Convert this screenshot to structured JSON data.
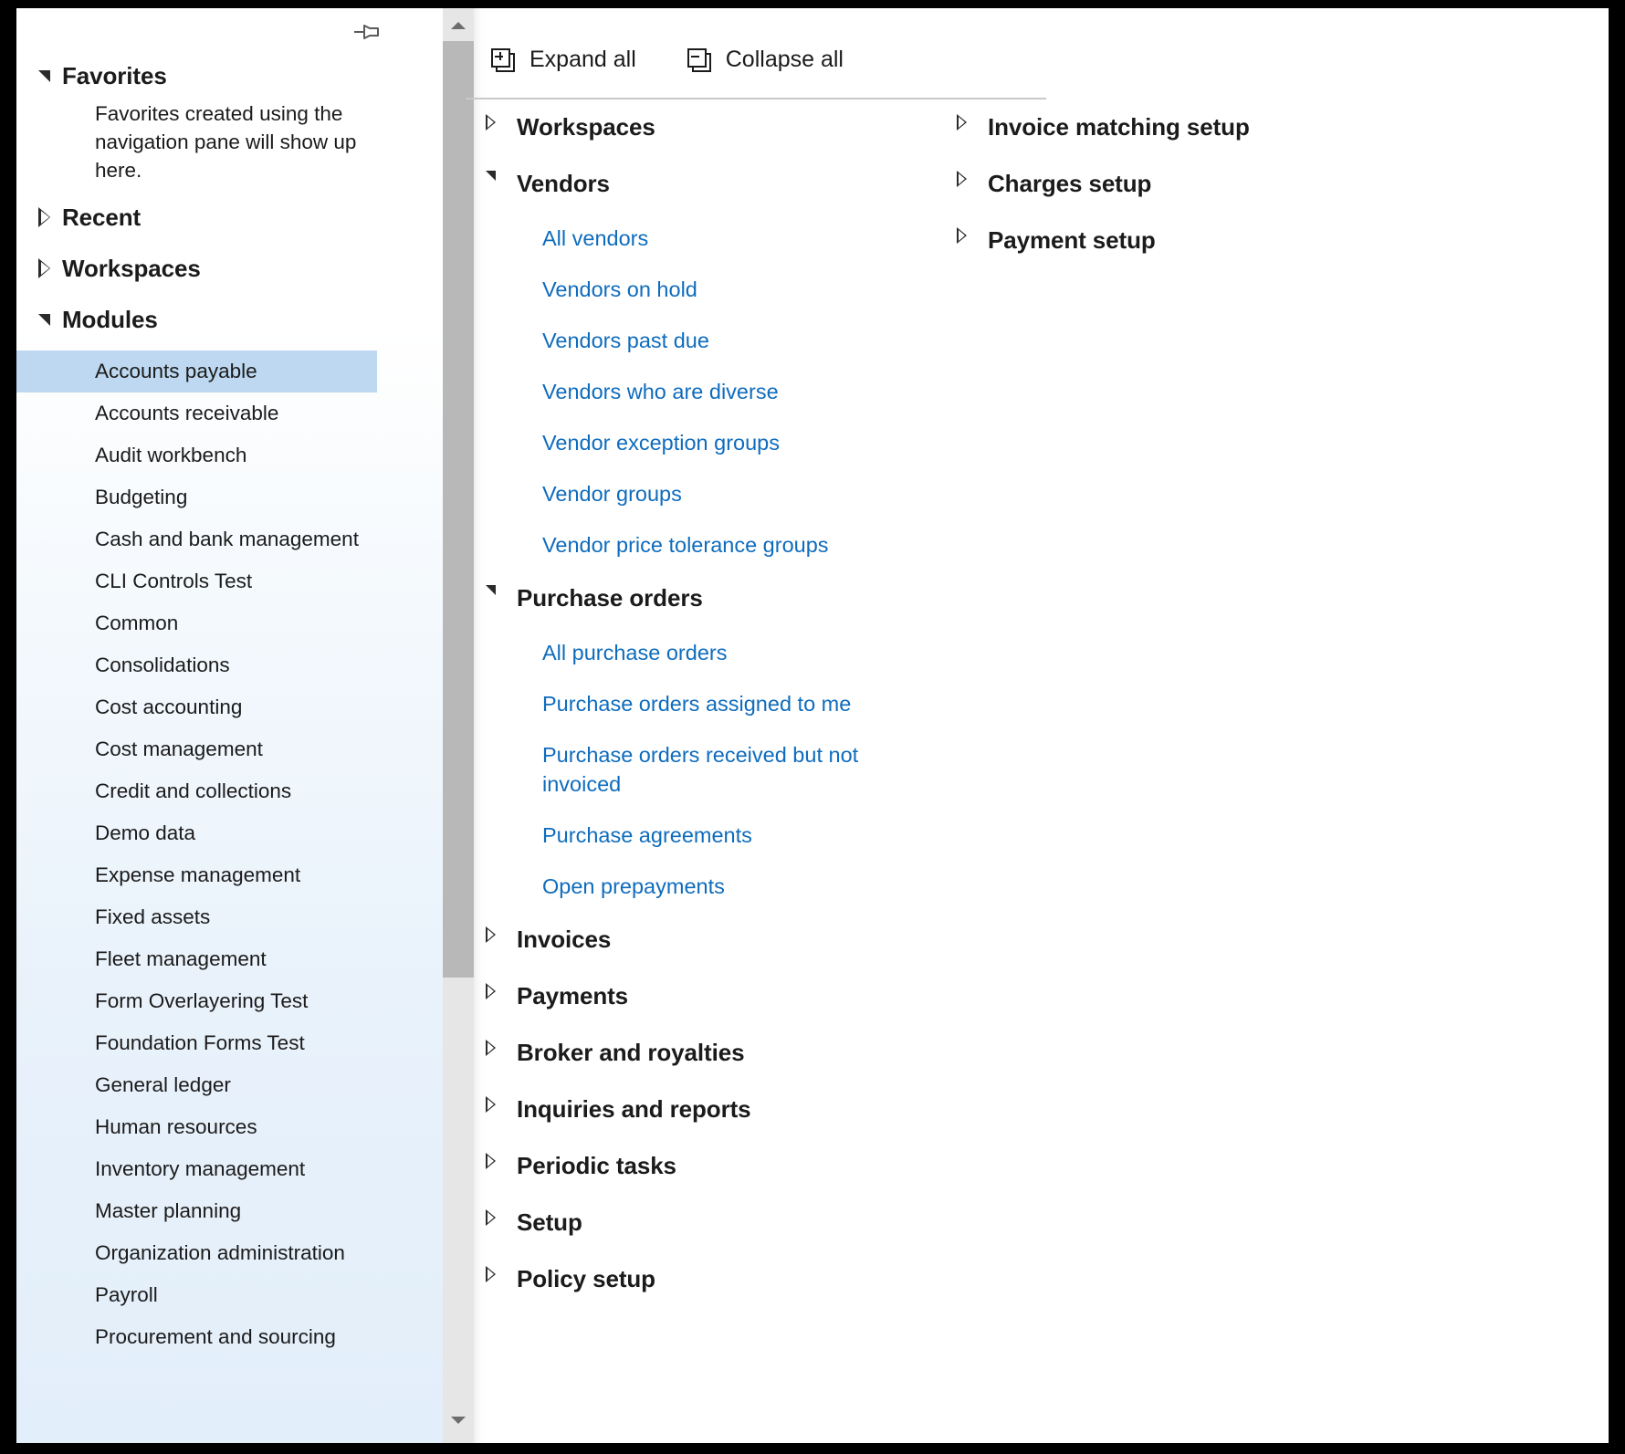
{
  "colors": {
    "link": "#0f6cbd",
    "selected_row": "#bdd8f0",
    "text": "#1b1b1b",
    "divider": "#c9c9c9",
    "scrollbar_thumb": "#b8b8b8",
    "scrollbar_track": "#e6e6e6"
  },
  "nav_pane": {
    "pin_icon": "pin-icon",
    "groups": [
      {
        "label": "Favorites",
        "expanded": true,
        "caret": "triangle-down-icon"
      },
      {
        "label": "Recent",
        "expanded": false,
        "caret": "triangle-right-icon"
      },
      {
        "label": "Workspaces",
        "expanded": false,
        "caret": "triangle-right-icon"
      },
      {
        "label": "Modules",
        "expanded": true,
        "caret": "triangle-down-icon"
      }
    ],
    "favorites_note": "Favorites created using the navigation pane will show up here.",
    "modules": [
      {
        "label": "Accounts payable",
        "selected": true
      },
      {
        "label": "Accounts receivable",
        "selected": false
      },
      {
        "label": "Audit workbench",
        "selected": false
      },
      {
        "label": "Budgeting",
        "selected": false
      },
      {
        "label": "Cash and bank management",
        "selected": false
      },
      {
        "label": "CLI Controls Test",
        "selected": false
      },
      {
        "label": "Common",
        "selected": false
      },
      {
        "label": "Consolidations",
        "selected": false
      },
      {
        "label": "Cost accounting",
        "selected": false
      },
      {
        "label": "Cost management",
        "selected": false
      },
      {
        "label": "Credit and collections",
        "selected": false
      },
      {
        "label": "Demo data",
        "selected": false
      },
      {
        "label": "Expense management",
        "selected": false
      },
      {
        "label": "Fixed assets",
        "selected": false
      },
      {
        "label": "Fleet management",
        "selected": false
      },
      {
        "label": "Form Overlayering Test",
        "selected": false
      },
      {
        "label": "Foundation Forms Test",
        "selected": false
      },
      {
        "label": "General ledger",
        "selected": false
      },
      {
        "label": "Human resources",
        "selected": false
      },
      {
        "label": "Inventory management",
        "selected": false
      },
      {
        "label": "Master planning",
        "selected": false
      },
      {
        "label": "Organization administration",
        "selected": false
      },
      {
        "label": "Payroll",
        "selected": false
      },
      {
        "label": "Procurement and sourcing",
        "selected": false
      }
    ],
    "scrollbar": {
      "up_arrow": "chevron-up-icon",
      "down_arrow": "chevron-down-icon"
    }
  },
  "toolbar": {
    "expand_all": {
      "label": "Expand all",
      "icon": "expand-all-icon"
    },
    "collapse_all": {
      "label": "Collapse all",
      "icon": "collapse-all-icon"
    }
  },
  "tree": {
    "left_column": [
      {
        "label": "Workspaces",
        "expanded": false,
        "children": []
      },
      {
        "label": "Vendors",
        "expanded": true,
        "children": [
          "All vendors",
          "Vendors on hold",
          "Vendors past due",
          "Vendors who are diverse",
          "Vendor exception groups",
          "Vendor groups",
          "Vendor price tolerance groups"
        ]
      },
      {
        "label": "Purchase orders",
        "expanded": true,
        "children": [
          "All purchase orders",
          "Purchase orders assigned to me",
          "Purchase orders received but not invoiced",
          "Purchase agreements",
          "Open prepayments"
        ]
      },
      {
        "label": "Invoices",
        "expanded": false,
        "children": []
      },
      {
        "label": "Payments",
        "expanded": false,
        "children": []
      },
      {
        "label": "Broker and royalties",
        "expanded": false,
        "children": []
      },
      {
        "label": "Inquiries and reports",
        "expanded": false,
        "children": []
      },
      {
        "label": "Periodic tasks",
        "expanded": false,
        "children": []
      },
      {
        "label": "Setup",
        "expanded": false,
        "children": []
      },
      {
        "label": "Policy setup",
        "expanded": false,
        "children": []
      }
    ],
    "right_column": [
      {
        "label": "Invoice matching setup",
        "expanded": false,
        "children": []
      },
      {
        "label": "Charges setup",
        "expanded": false,
        "children": []
      },
      {
        "label": "Payment setup",
        "expanded": false,
        "children": []
      }
    ]
  }
}
